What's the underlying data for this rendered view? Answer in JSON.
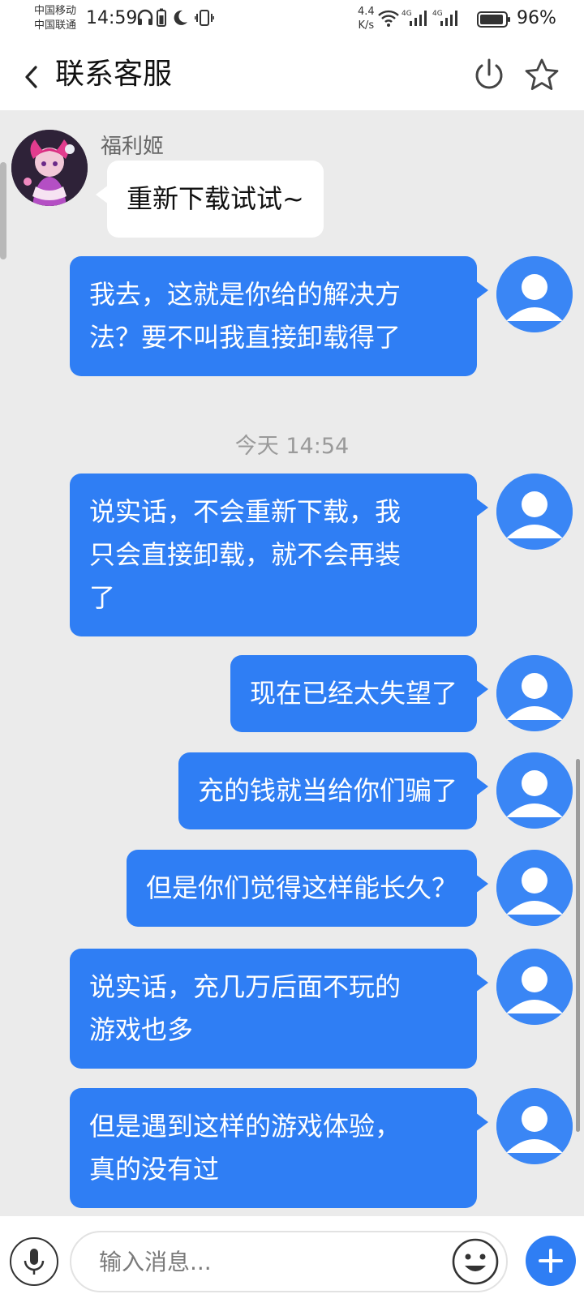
{
  "status_bar": {
    "carrier_1": "中国移动",
    "carrier_2": "中国联通",
    "time": "14:59",
    "net_speed_value": "4.4",
    "net_speed_unit": "K/s",
    "signal_1_label": "4G",
    "signal_2_label": "4G",
    "battery_percent": "96%",
    "icons": [
      "headphones-icon",
      "battery-saver-icon",
      "moon-icon",
      "vibrate-icon",
      "wifi-icon",
      "signal-icon",
      "battery-icon"
    ]
  },
  "header": {
    "title": "联系客服",
    "icons": [
      "back-icon",
      "power-icon",
      "star-icon"
    ]
  },
  "messages": [
    {
      "direction": "in",
      "sender": "福利姬",
      "text": "重新下载试试~"
    },
    {
      "direction": "out",
      "text": "我去，这就是你给的解决方\n法？要不叫我直接卸载得了"
    },
    {
      "type": "timestamp",
      "text": "今天 14:54"
    },
    {
      "direction": "out",
      "text": "说实话，不会重新下载，我\n只会直接卸载，就不会再装\n了"
    },
    {
      "direction": "out",
      "text": "现在已经太失望了"
    },
    {
      "direction": "out",
      "text": "充的钱就当给你们骗了"
    },
    {
      "direction": "out",
      "text": "但是你们觉得这样能长久？"
    },
    {
      "direction": "out",
      "text": "说实话，充几万后面不玩的\n游戏也多"
    },
    {
      "direction": "out",
      "text": "但是遇到这样的游戏体验，\n真的没有过"
    }
  ],
  "input": {
    "placeholder": "输入消息...",
    "icons": [
      "microphone-icon",
      "emoji-icon",
      "plus-icon"
    ]
  },
  "colors": {
    "bubble_out": "#2f7ef4",
    "bubble_in": "#ffffff",
    "background": "#ebebeb",
    "accent": "#2f7ef4"
  }
}
